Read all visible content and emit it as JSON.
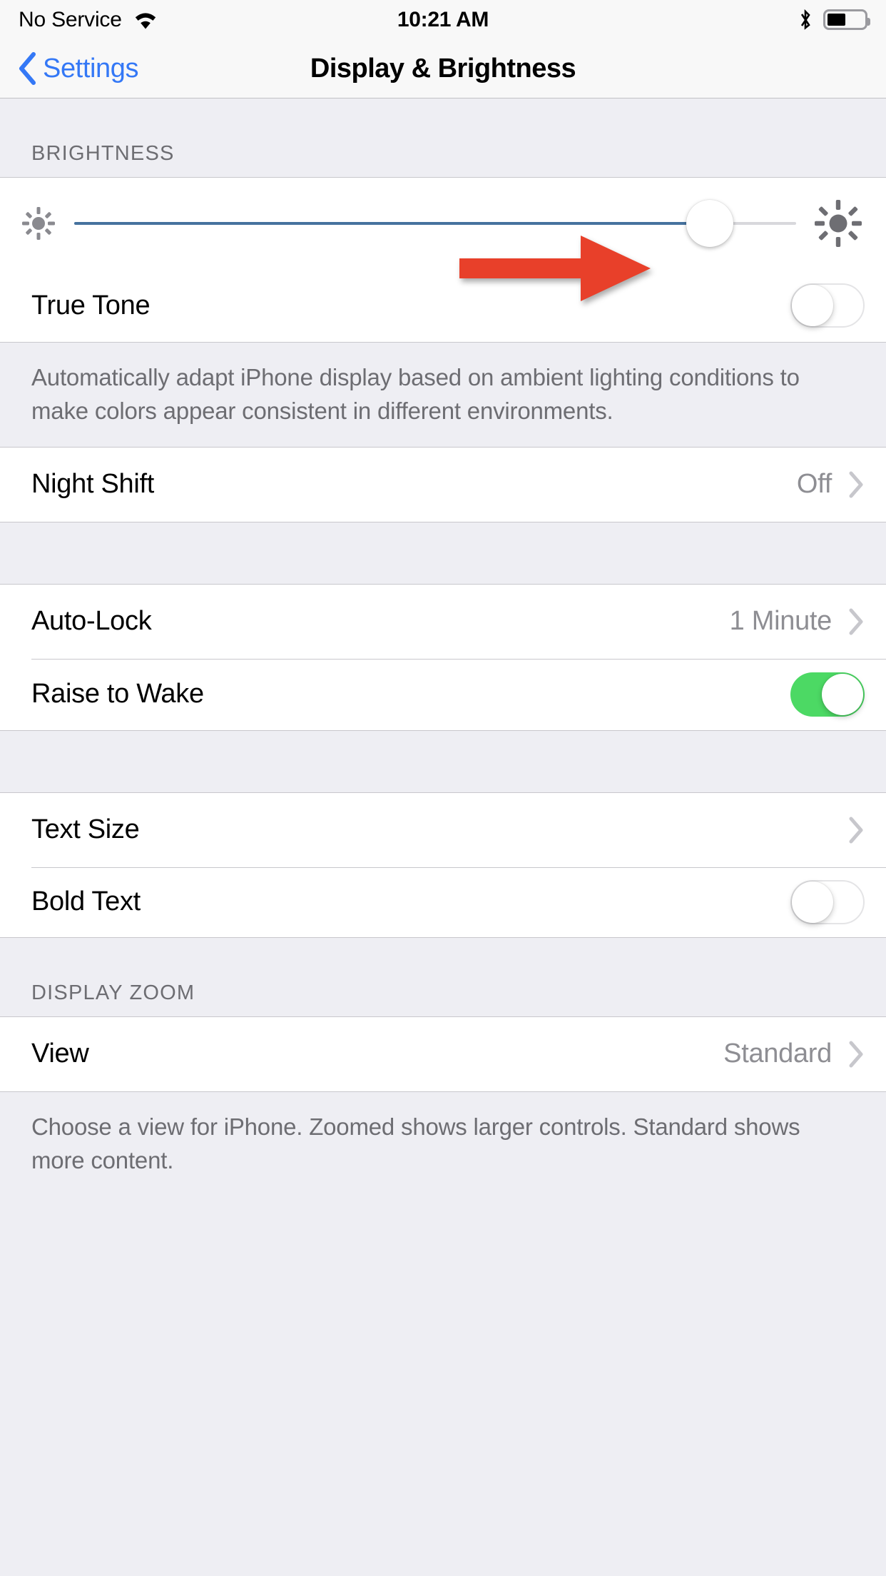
{
  "status_bar": {
    "carrier": "No Service",
    "time": "10:21 AM",
    "wifi_icon": "wifi-icon",
    "bluetooth_icon": "bluetooth-icon",
    "battery_icon": "battery-icon",
    "battery_level_percent": 50
  },
  "nav": {
    "back_label": "Settings",
    "back_icon": "chevron-left-icon",
    "title": "Display & Brightness"
  },
  "colors": {
    "accent_blue": "#3478f6",
    "slider_blue": "#46729e",
    "toggle_on_green": "#4cd964",
    "annotation_red": "#e8402a",
    "group_bg": "#ffffff",
    "page_bg": "#eeeef3",
    "secondary_text": "#8e8e93",
    "header_text": "#6d6d72"
  },
  "sections": {
    "brightness": {
      "header": "BRIGHTNESS",
      "slider": {
        "name": "brightness-slider",
        "value_percent": 88,
        "low_icon": "sun-small-icon",
        "high_icon": "sun-large-icon"
      },
      "true_tone": {
        "label": "True Tone",
        "toggle_state": "off"
      },
      "footnote": "Automatically adapt iPhone display based on ambient lighting conditions to make colors appear consistent in different environments.",
      "night_shift": {
        "label": "Night Shift",
        "value": "Off",
        "chevron_icon": "chevron-right-icon"
      }
    },
    "lock": {
      "auto_lock": {
        "label": "Auto-Lock",
        "value": "1 Minute",
        "chevron_icon": "chevron-right-icon"
      },
      "raise_to_wake": {
        "label": "Raise to Wake",
        "toggle_state": "on"
      }
    },
    "text": {
      "text_size": {
        "label": "Text Size",
        "value": "",
        "chevron_icon": "chevron-right-icon"
      },
      "bold_text": {
        "label": "Bold Text",
        "toggle_state": "off"
      }
    },
    "display_zoom": {
      "header": "DISPLAY ZOOM",
      "view": {
        "label": "View",
        "value": "Standard",
        "chevron_icon": "chevron-right-icon"
      },
      "footnote": "Choose a view for iPhone. Zoomed shows larger controls. Standard shows more content."
    }
  },
  "annotation": {
    "arrow_icon": "red-arrow-right-icon",
    "points_at": "True Tone toggle"
  }
}
